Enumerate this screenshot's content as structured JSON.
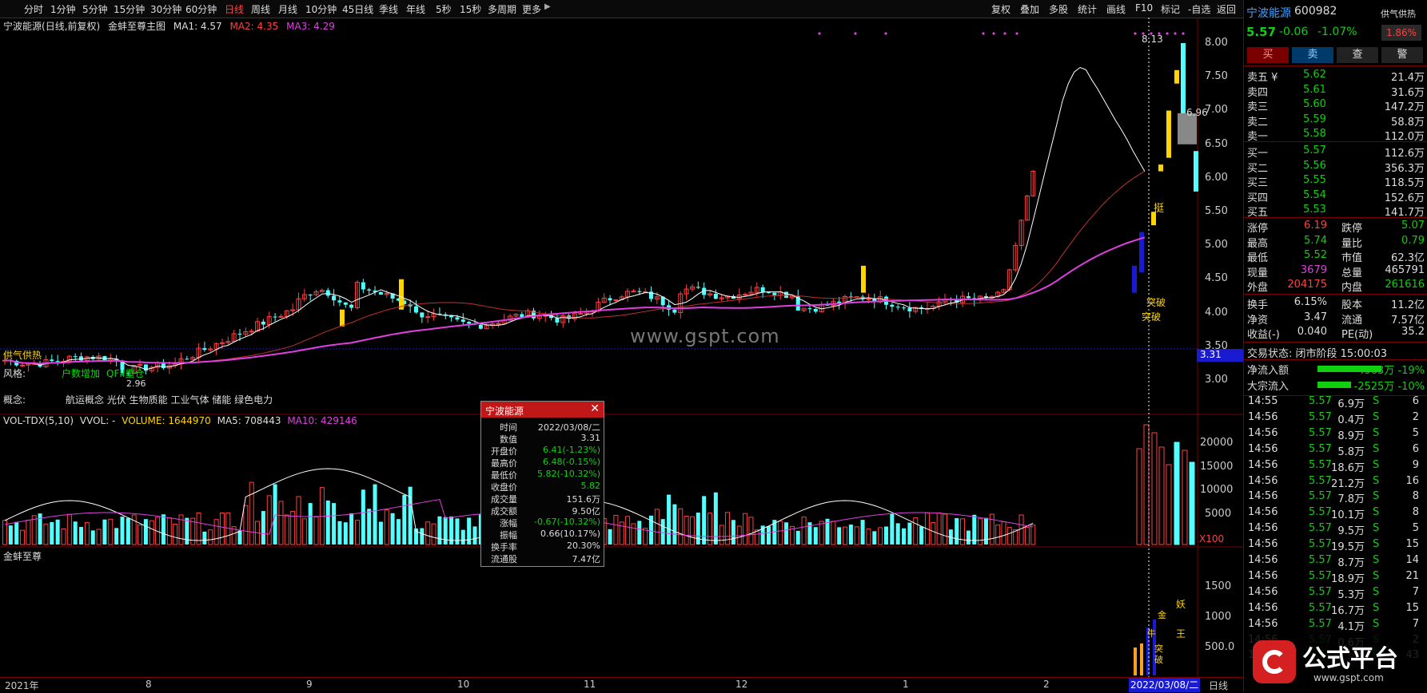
{
  "toolbar": {
    "tabs": [
      "分时",
      "1分钟",
      "5分钟",
      "15分钟",
      "30分钟",
      "60分钟",
      "日线",
      "周线",
      "月线",
      "10分钟",
      "45日线",
      "季线",
      "年线",
      "5秒",
      "15秒",
      "多周期",
      "更多"
    ],
    "active_tab": "日线",
    "tools": [
      "复权",
      "叠加",
      "多股",
      "统计",
      "画线",
      "F10",
      "标记",
      "-自选",
      "返回"
    ]
  },
  "main_chart": {
    "header": {
      "stock": "宁波能源",
      "mode": "(日线,前复权)",
      "indicator": "金蚌至尊主图",
      "ma1": "MA1: 4.57",
      "ma2": "MA2: 4.35",
      "ma3": "MA3: 4.29"
    },
    "y_labels": [
      "8.00",
      "7.50",
      "7.00",
      "6.50",
      "6.00",
      "5.50",
      "5.00",
      "4.50",
      "4.00",
      "3.50",
      "3.00"
    ],
    "price_tag": "3.31",
    "labels": {
      "high_mark": "8.13",
      "mid_mark": "6.96",
      "low_mark": "2.96",
      "tupo1": "突破",
      "tupo2": "突破",
      "ting": "挺",
      "gongqi": "供气供热",
      "fengge_label": "风格:",
      "fengge_1": "户数增加",
      "fengge_2": "QFII重仓",
      "gainian_label": "概念:",
      "gainian_value": "航运概念 光伏 生物质能 工业气体 储能 绿色电力",
      "watermark": "www.gspt.com"
    }
  },
  "volume_chart": {
    "header": {
      "name": "VOL-TDX(5,10)",
      "vvol": "VVOL: -",
      "volume": "VOLUME: 1644970",
      "ma5": "MA5: 708443",
      "ma10": "MA10: 429146"
    },
    "y_labels": [
      "20000",
      "15000",
      "10000",
      "5000"
    ],
    "unit": "X100"
  },
  "sub_chart": {
    "header": "金蚌至尊",
    "y_labels": [
      "1500",
      "1000",
      "500.0"
    ],
    "signals": [
      "妖",
      "王",
      "金",
      "突",
      "破",
      "牛"
    ]
  },
  "x_axis": {
    "labels": [
      "2021年",
      "8",
      "9",
      "10",
      "11",
      "12",
      "1",
      "2"
    ],
    "current_date": "2022/03/08/二",
    "period": "日线"
  },
  "popup": {
    "title": "宁波能源",
    "rows": [
      {
        "k": "时间",
        "v": "2022/03/08/二",
        "c": "#ddd"
      },
      {
        "k": "数值",
        "v": "3.31",
        "c": "#ddd"
      },
      {
        "k": "开盘价",
        "v": "6.41(-1.23%)",
        "c": "#10d010"
      },
      {
        "k": "最高价",
        "v": "6.48(-0.15%)",
        "c": "#10d010"
      },
      {
        "k": "最低价",
        "v": "5.82(-10.32%)",
        "c": "#10d010"
      },
      {
        "k": "收盘价",
        "v": "5.82",
        "c": "#10d010"
      },
      {
        "k": "成交量",
        "v": "151.6万",
        "c": "#ddd"
      },
      {
        "k": "成交额",
        "v": "9.50亿",
        "c": "#ddd"
      },
      {
        "k": "涨幅",
        "v": "-0.67(-10.32%)",
        "c": "#10d010"
      },
      {
        "k": "振幅",
        "v": "0.66(10.17%)",
        "c": "#ddd"
      },
      {
        "k": "换手率",
        "v": "20.30%",
        "c": "#ddd"
      },
      {
        "k": "流通股",
        "v": "7.47亿",
        "c": "#ddd"
      }
    ]
  },
  "quote": {
    "name": "宁波能源",
    "code": "600982",
    "badge": "供气供热",
    "price": "5.57",
    "change": "-0.06",
    "change_pct": "-1.07%",
    "turnover_box": "1.86%",
    "buttons": [
      "买",
      "卖",
      "查",
      "警"
    ],
    "asks": [
      {
        "k": "卖五",
        "p": "5.62",
        "v": "21.4万",
        "mark": "¥"
      },
      {
        "k": "卖四",
        "p": "5.61",
        "v": "31.6万",
        "mark": ""
      },
      {
        "k": "卖三",
        "p": "5.60",
        "v": "147.2万",
        "mark": ""
      },
      {
        "k": "卖二",
        "p": "5.59",
        "v": "58.8万",
        "mark": ""
      },
      {
        "k": "卖一",
        "p": "5.58",
        "v": "112.0万",
        "mark": ""
      }
    ],
    "bids": [
      {
        "k": "买一",
        "p": "5.57",
        "v": "112.6万"
      },
      {
        "k": "买二",
        "p": "5.56",
        "v": "356.3万"
      },
      {
        "k": "买三",
        "p": "5.55",
        "v": "118.5万"
      },
      {
        "k": "买四",
        "p": "5.54",
        "v": "152.6万"
      },
      {
        "k": "买五",
        "p": "5.53",
        "v": "141.7万"
      }
    ],
    "stats": [
      {
        "k1": "涨停",
        "v1": "6.19",
        "c1": "#ff4040",
        "k2": "跌停",
        "v2": "5.07",
        "c2": "#10d010"
      },
      {
        "k1": "最高",
        "v1": "5.74",
        "c1": "#10d010",
        "k2": "量比",
        "v2": "0.79",
        "c2": "#10d010"
      },
      {
        "k1": "最低",
        "v1": "5.52",
        "c1": "#10d010",
        "k2": "市值",
        "v2": "62.3亿",
        "c2": "#ddd"
      },
      {
        "k1": "现量",
        "v1": "3679",
        "c1": "#e040e0",
        "k2": "总量",
        "v2": "465791",
        "c2": "#ddd"
      },
      {
        "k1": "外盘",
        "v1": "204175",
        "c1": "#ff4040",
        "k2": "内盘",
        "v2": "261616",
        "c2": "#10d010"
      }
    ],
    "stats2": [
      {
        "k1": "换手",
        "v1": "6.15%",
        "k2": "股本",
        "v2": "11.2亿"
      },
      {
        "k1": "净资",
        "v1": "3.47",
        "k2": "流通",
        "v2": "7.57亿"
      },
      {
        "k1": "收益(-)",
        "v1": "0.040",
        "k2": "PE(动)",
        "v2": "35.2"
      }
    ],
    "status": "交易状态: 闭市阶段 15:00:03",
    "flows": [
      {
        "k": "净流入额",
        "v": "-4963万 -19%",
        "fill": 0.19
      },
      {
        "k": "大宗流入",
        "v": "-2525万 -10%",
        "fill": 0.1
      }
    ]
  },
  "ticks": [
    {
      "t": "14:55",
      "p": "5.57",
      "v": "6.9万",
      "s": "S",
      "n": "6"
    },
    {
      "t": "14:56",
      "p": "5.57",
      "v": "0.4万",
      "s": "S",
      "n": "2"
    },
    {
      "t": "14:56",
      "p": "5.57",
      "v": "8.9万",
      "s": "S",
      "n": "5"
    },
    {
      "t": "14:56",
      "p": "5.57",
      "v": "5.8万",
      "s": "S",
      "n": "6"
    },
    {
      "t": "14:56",
      "p": "5.57",
      "v": "18.6万",
      "s": "S",
      "n": "9"
    },
    {
      "t": "14:56",
      "p": "5.57",
      "v": "21.2万",
      "s": "S",
      "n": "16"
    },
    {
      "t": "14:56",
      "p": "5.57",
      "v": "7.8万",
      "s": "S",
      "n": "8"
    },
    {
      "t": "14:56",
      "p": "5.57",
      "v": "10.1万",
      "s": "S",
      "n": "8"
    },
    {
      "t": "14:56",
      "p": "5.57",
      "v": "9.5万",
      "s": "S",
      "n": "5"
    },
    {
      "t": "14:56",
      "p": "5.57",
      "v": "19.5万",
      "s": "S",
      "n": "15"
    },
    {
      "t": "14:56",
      "p": "5.57",
      "v": "8.7万",
      "s": "S",
      "n": "14"
    },
    {
      "t": "14:56",
      "p": "5.57",
      "v": "18.9万",
      "s": "S",
      "n": "21"
    },
    {
      "t": "14:56",
      "p": "5.57",
      "v": "5.3万",
      "s": "S",
      "n": "7"
    },
    {
      "t": "14:56",
      "p": "5.57",
      "v": "16.7万",
      "s": "S",
      "n": "15"
    },
    {
      "t": "14:56",
      "p": "5.57",
      "v": "4.1万",
      "s": "S",
      "n": "7"
    },
    {
      "t": "14:56",
      "p": "5.57",
      "v": "0.6万",
      "s": "S",
      "n": "2"
    },
    {
      "t": "14:56",
      "p": "5.57",
      "v": "44.8万",
      "s": "S",
      "n": "43"
    }
  ],
  "logo": {
    "text": "公式平台",
    "url_text": "www.gspt.com"
  },
  "colors": {
    "up": "#ff4040",
    "down": "#10d010",
    "candle_down": "#54ffff",
    "ma3": "#e040e0",
    "accent": "#c01818"
  }
}
